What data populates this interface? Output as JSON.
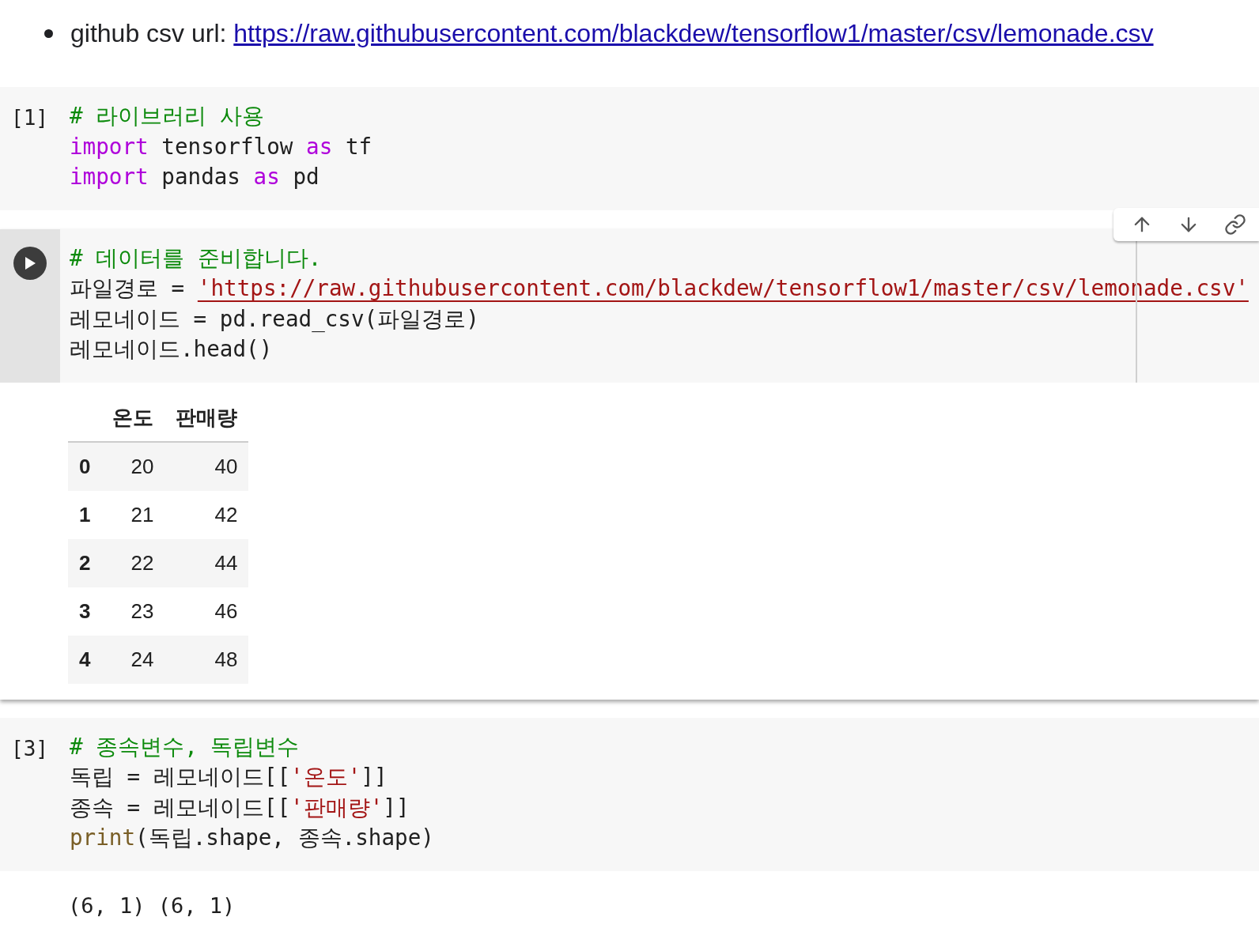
{
  "bullet": {
    "label": "github csv url: ",
    "link": "https://raw.githubusercontent.com/blackdew/tensorflow1/master/csv/lemonade.csv"
  },
  "cells": [
    {
      "prompt": "[1]",
      "focused": false,
      "lines": [
        [
          {
            "kind": "comment",
            "text": "# 라이브러리 사용"
          }
        ],
        [
          {
            "kind": "keyword",
            "text": "import"
          },
          {
            "kind": "plain",
            "text": " tensorflow "
          },
          {
            "kind": "keyword",
            "text": "as"
          },
          {
            "kind": "plain",
            "text": " tf"
          }
        ],
        [
          {
            "kind": "keyword",
            "text": "import"
          },
          {
            "kind": "plain",
            "text": " pandas "
          },
          {
            "kind": "keyword",
            "text": "as"
          },
          {
            "kind": "plain",
            "text": " pd"
          }
        ]
      ]
    },
    {
      "focused": true,
      "lines": [
        [
          {
            "kind": "comment",
            "text": "# 데이터를 준비합니다."
          }
        ],
        [
          {
            "kind": "plain",
            "text": "파일경로 = "
          },
          {
            "kind": "link-string",
            "text": "'https://raw.githubusercontent.com/blackdew/tensorflow1/master/csv/lemonade.csv'"
          }
        ],
        [
          {
            "kind": "plain",
            "text": "레모네이드 = pd.read_csv(파일경로)"
          }
        ],
        [
          {
            "kind": "plain",
            "text": "레모네이드.head()"
          }
        ]
      ],
      "output": {
        "kind": "table",
        "columns": [
          "",
          "온도",
          "판매량"
        ],
        "rows": [
          [
            "0",
            "20",
            "40"
          ],
          [
            "1",
            "21",
            "42"
          ],
          [
            "2",
            "22",
            "44"
          ],
          [
            "3",
            "23",
            "46"
          ],
          [
            "4",
            "24",
            "48"
          ]
        ]
      }
    },
    {
      "prompt": "[3]",
      "focused": false,
      "lines": [
        [
          {
            "kind": "comment",
            "text": "# 종속변수, 독립변수"
          }
        ],
        [
          {
            "kind": "plain",
            "text": "독립 = 레모네이드[["
          },
          {
            "kind": "string",
            "text": "'온도'"
          },
          {
            "kind": "plain",
            "text": "]]"
          }
        ],
        [
          {
            "kind": "plain",
            "text": "종속 = 레모네이드[["
          },
          {
            "kind": "string",
            "text": "'판매량'"
          },
          {
            "kind": "plain",
            "text": "]]"
          }
        ],
        [
          {
            "kind": "builtin",
            "text": "print"
          },
          {
            "kind": "plain",
            "text": "(독립.shape, 종속.shape)"
          }
        ]
      ],
      "output": {
        "kind": "text",
        "text": "(6, 1) (6, 1)"
      }
    }
  ]
}
